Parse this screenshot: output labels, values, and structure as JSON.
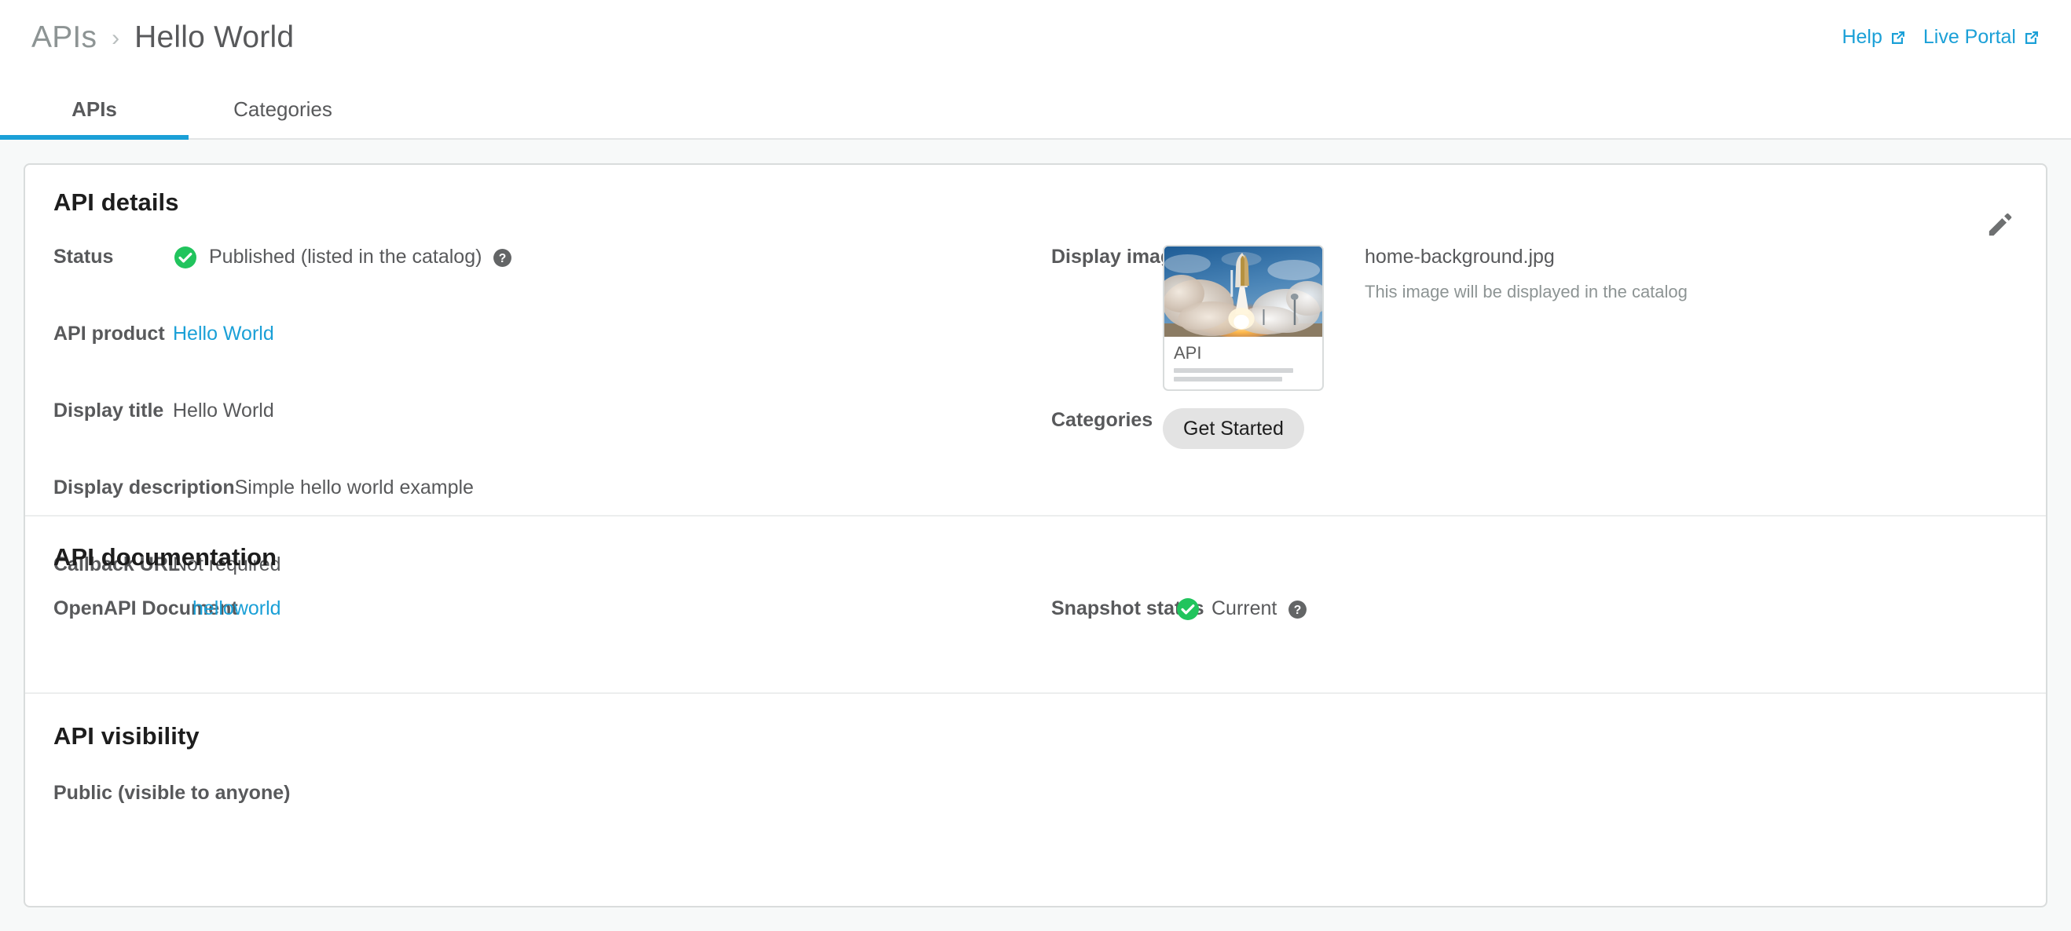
{
  "header": {
    "breadcrumb": {
      "root": "APIs",
      "separator": "›",
      "current": "Hello World"
    },
    "links": [
      {
        "label": "Help",
        "icon": "external-link-icon"
      },
      {
        "label": "Live Portal",
        "icon": "external-link-icon"
      }
    ]
  },
  "tabs": [
    {
      "label": "APIs",
      "active": true
    },
    {
      "label": "Categories",
      "active": false
    }
  ],
  "card": {
    "edit_icon": "pencil-icon",
    "details": {
      "title": "API details",
      "status": {
        "label": "Status",
        "value": "Published (listed in the catalog)",
        "status_icon": "check-circle-icon",
        "help_icon": "question-mark-icon"
      },
      "api_product": {
        "label": "API product",
        "value": "Hello World"
      },
      "display_title": {
        "label": "Display title",
        "value": "Hello World"
      },
      "display_description": {
        "label": "Display description",
        "value": "Simple hello world example"
      },
      "callback_url": {
        "label": "Callback URL",
        "value": "Not required"
      },
      "display_image": {
        "label": "Display image",
        "thumbnail_caption": "API",
        "thumbnail_image": "space-shuttle-launch-photo",
        "filename": "home-background.jpg",
        "hint": "This image will be displayed in the catalog"
      },
      "categories": {
        "label": "Categories",
        "chips": [
          "Get Started"
        ]
      }
    },
    "documentation": {
      "title": "API documentation",
      "openapi": {
        "label": "OpenAPI Document",
        "value": "helloworld"
      },
      "snapshot": {
        "label": "Snapshot status",
        "value": "Current",
        "status_icon": "check-circle-icon",
        "help_icon": "question-mark-icon"
      }
    },
    "visibility": {
      "title": "API visibility",
      "value": "Public (visible to anyone)"
    }
  },
  "colors": {
    "accent_blue": "#1ba0d7",
    "success_green": "#21c45d",
    "text_dark": "#1d1d1d",
    "text_gray": "#58595b",
    "muted_gray": "#8d9494",
    "page_bg": "#f7f9f9",
    "chip_bg": "#e3e3e3"
  }
}
